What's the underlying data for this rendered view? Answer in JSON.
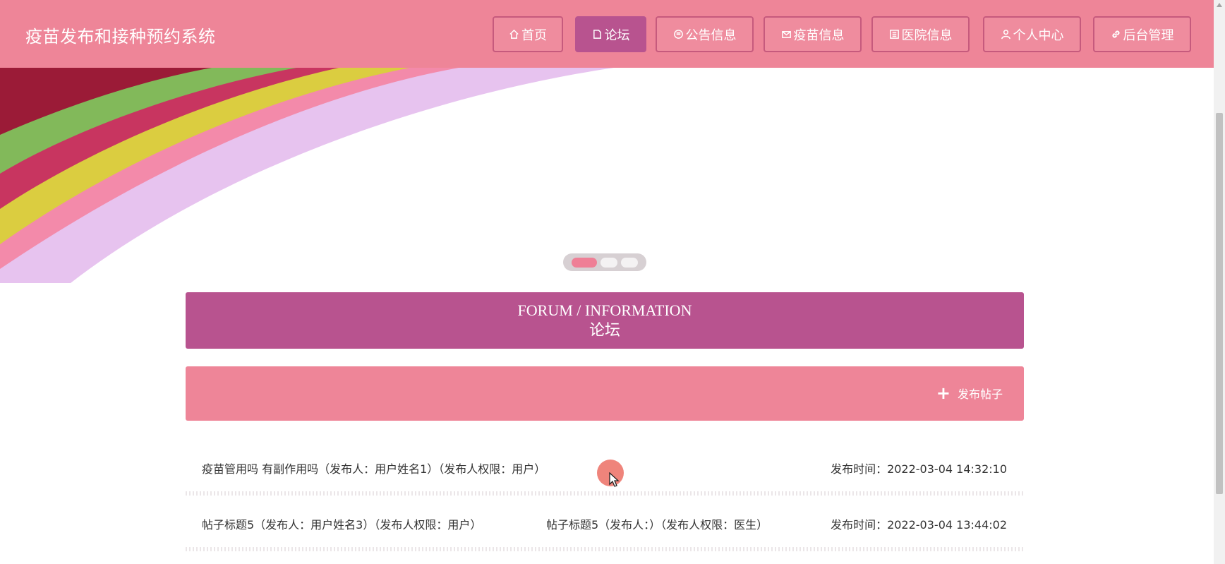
{
  "header": {
    "site_title": "疫苗发布和接种预约系统",
    "nav": [
      {
        "label": "首页",
        "icon": "home-icon",
        "active": false
      },
      {
        "label": "论坛",
        "icon": "note-icon",
        "active": true
      },
      {
        "label": "公告信息",
        "icon": "announcement-icon",
        "active": false
      },
      {
        "label": "疫苗信息",
        "icon": "mail-icon",
        "active": false
      },
      {
        "label": "医院信息",
        "icon": "hospital-icon",
        "active": false
      },
      {
        "label": "个人中心",
        "icon": "user-icon",
        "active": false
      },
      {
        "label": "后台管理",
        "icon": "link-icon",
        "active": false
      }
    ]
  },
  "banner": {
    "slide_count": 3,
    "active_slide": 1
  },
  "forum": {
    "title_en": "FORUM / INFORMATION",
    "title_cn": "论坛",
    "post_button_label": "发布帖子"
  },
  "posts": [
    {
      "title": "疫苗管用吗 有副作用吗（发布人：用户姓名1）（发布人权限：用户）",
      "title2": "",
      "time": "发布时间：2022-03-04 14:32:10"
    },
    {
      "title": "帖子标题5（发布人：用户姓名3）（发布人权限：用户）",
      "title2": "帖子标题5（发布人：）（发布人权限：医生）",
      "time": "发布时间：2022-03-04 13:44:02"
    }
  ],
  "colors": {
    "header_bg": "#ee8598",
    "active_nav": "#b8538f",
    "forum_head_bg": "#b8538f",
    "action_bar_bg": "#ee8598"
  }
}
